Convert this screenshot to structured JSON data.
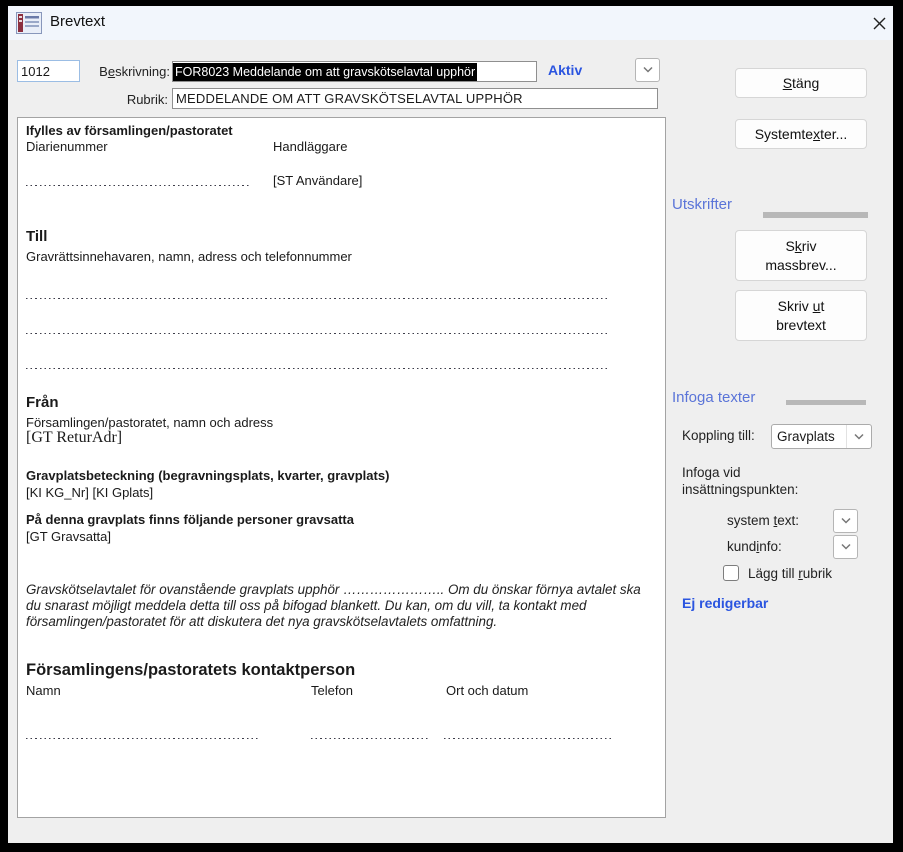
{
  "window": {
    "title": "Brevtext"
  },
  "fields": {
    "id_value": "1012",
    "beskrivning_label": {
      "pre": "B",
      "accel": "e",
      "post": "skrivning:"
    },
    "beskrivning_value": "FOR8023 Meddelande om att gravskötselavtal upphör",
    "status_text": "Aktiv",
    "rubrik_label": "Rubrik:",
    "rubrik_value": "MEDDELANDE OM ATT GRAVSKÖTSELAVTAL UPPHÖR"
  },
  "letter": {
    "ifylles_title": "Ifylles av församlingen/pastoratet",
    "diarienummer": "Diarienummer",
    "handlaggare": "Handläggare",
    "st_anvandare": "[ST Användare]",
    "till_title": "Till",
    "till_subtitle": "Gravrättsinnehavaren, namn, adress och telefonnummer",
    "fran_title": "Från",
    "fran_subtitle": "Församlingen/pastoratet, namn och adress",
    "gt_returadr": "[GT ReturAdr]",
    "gravplatsbeteckning_title": "Gravplatsbeteckning (begravningsplats, kvarter, gravplats)",
    "ki_fields": "[KI KG_Nr] [KI Gplats]",
    "gravsatta_title": "På denna gravplats finns följande personer gravsatta",
    "gt_gravsatta": "[GT Gravsatta]",
    "notice_lines": [
      "Gravskötselavtalet för ovanstående gravplats upphör ………………….. Om du önskar förnya avtalet ska",
      "du snarast möjligt meddela detta till oss på bifogad blankett. Du kan, om du vill, ta kontakt med",
      "församlingen/pastoratet för att diskutera det nya gravskötselavtalets omfattning."
    ],
    "kontakt_title": "Församlingens/pastoratets kontaktperson",
    "namn": "Namn",
    "telefon": "Telefon",
    "ort_och_datum": "Ort och datum"
  },
  "right_panel": {
    "stang": {
      "pre": "",
      "accel": "S",
      "post": "täng"
    },
    "systemtexter": {
      "pre": "Systemte",
      "accel": "x",
      "post": "ter..."
    },
    "utskrifter_header": "Utskrifter",
    "skriv_massbrev": {
      "line1": {
        "pre": "S",
        "accel": "k",
        "post": "riv"
      },
      "line2": "massbrev..."
    },
    "skriv_ut": {
      "line1": {
        "pre": "Skriv ",
        "accel": "u",
        "post": "t"
      },
      "line2": "brevtext"
    },
    "infoga_header": "Infoga texter",
    "koppling_label": "Koppling till:",
    "koppling_value": "Gravplats",
    "infoga_vid_label": "Infoga vid insättningspunkten:",
    "system_text_label": {
      "pre": "system ",
      "accel": "t",
      "post": "ext:"
    },
    "kundinfo_label": {
      "pre": "kund",
      "accel": "i",
      "post": "nfo:"
    },
    "lagg_till_rubrik": {
      "pre": "Lägg till ",
      "accel": "r",
      "post": "ubrik"
    },
    "ej_redigerbar": "Ej redigerbar"
  },
  "icons": {
    "titlebar": "form-icon",
    "close": "close-icon",
    "dropdown": "chevron-down-icon"
  },
  "colors": {
    "accent_blue": "#2b55e0",
    "section_header_blue": "#5a74d8",
    "selection_bg": "#000000",
    "selection_fg": "#ffffff",
    "dialog_bg": "#efefef",
    "titlebar_bg": "#f2f6fc"
  }
}
